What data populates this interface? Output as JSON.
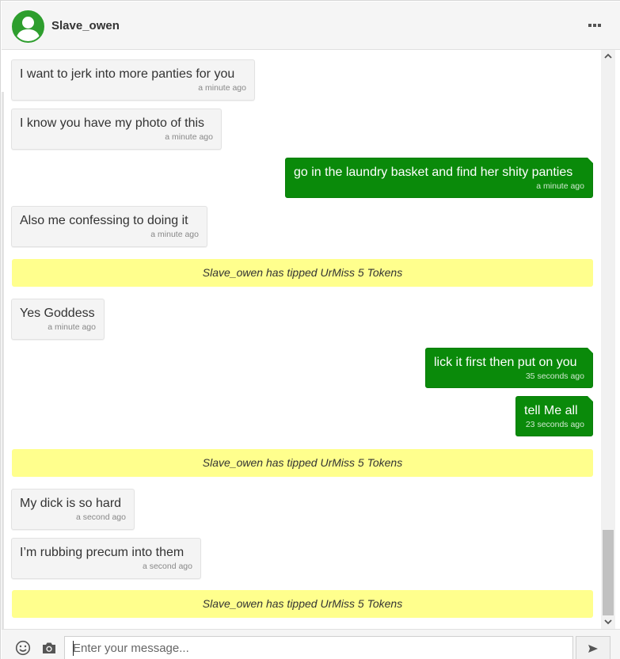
{
  "header": {
    "username": "Slave_owen",
    "menu_icon": "more-horizontal-icon",
    "avatar_icon": "user-avatar-icon"
  },
  "colors": {
    "outgoing_bubble": "#0a8a0a",
    "incoming_bubble": "#f4f4f4",
    "tip_banner": "#ffff8d",
    "avatar": "#2e9e2e"
  },
  "messages": [
    {
      "type": "in",
      "text": "I want to jerk into more panties for you",
      "time": "a minute ago"
    },
    {
      "type": "in",
      "text": "I know you have my photo of this",
      "time": "a minute ago"
    },
    {
      "type": "out",
      "text": "go in the laundry basket and find her shity panties",
      "time": "a minute ago"
    },
    {
      "type": "in",
      "text": "Also me confessing to doing it",
      "time": "a minute ago"
    },
    {
      "type": "tip",
      "text": "Slave_owen has tipped UrMiss 5 Tokens"
    },
    {
      "type": "in",
      "text": "Yes Goddess",
      "time": "a minute ago"
    },
    {
      "type": "out",
      "text": "lick it first then put on you",
      "time": "35 seconds ago"
    },
    {
      "type": "out",
      "text": "tell Me all",
      "time": "23 seconds ago"
    },
    {
      "type": "tip",
      "text": "Slave_owen has tipped UrMiss 5 Tokens"
    },
    {
      "type": "in",
      "text": "My dick is so hard",
      "time": "a second ago"
    },
    {
      "type": "in",
      "text": "I’m rubbing precum into them",
      "time": "a second ago"
    },
    {
      "type": "tip",
      "text": "Slave_owen has tipped UrMiss 5 Tokens"
    }
  ],
  "footer": {
    "input_placeholder": "Enter your message...",
    "emoji_icon": "smiley-icon",
    "camera_icon": "camera-icon",
    "send_icon": "send-icon"
  }
}
